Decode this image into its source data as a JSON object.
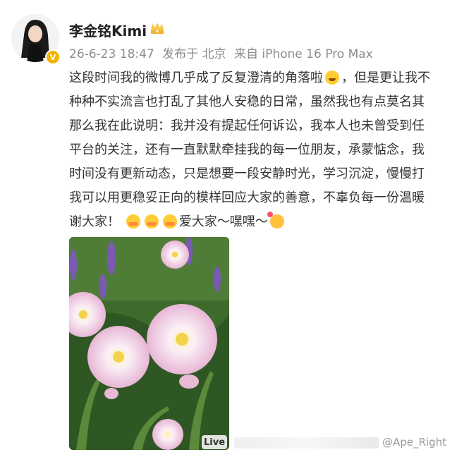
{
  "post": {
    "username": "李金铭Kimi",
    "meta": {
      "date": "26-6-23 18:47",
      "published_in": "发布于 北京",
      "device": "来自 iPhone 16 Pro Max"
    },
    "lines": [
      "这段时间我的微博几乎成了反复澄清的角落啦",
      "，但是更让我不",
      "种种不实流言也打乱了其他人安稳的日常，虽然我也有点莫名其",
      "那么我在此说明：我并没有提起任何诉讼，我本人也未曾受到任",
      "平台的关注，还有一直默默牵挂我的每一位朋友，承蒙惦念，我",
      "时间没有更新动态，只是想要一段安静时光，学习沉淀，慢慢打",
      "我可以用更稳妥正向的模样回应大家的善意，不辜负每一份温暖",
      "谢大家！",
      "爱大家～嘿嘿～"
    ],
    "live_badge": "Live",
    "watermark": "@Ape_Right"
  },
  "icons": {
    "avatar": "avatar-photo",
    "verified": "verified-badge-icon",
    "crown": "crown-icon",
    "emoji_laugh": "laugh-cry-emoji",
    "emoji_hug": "hug-emoji",
    "emoji_party": "party-emoji"
  },
  "colors": {
    "meta_text": "#8c8c8c",
    "verified_badge": "#f5b400",
    "crown": "#f2b233"
  }
}
